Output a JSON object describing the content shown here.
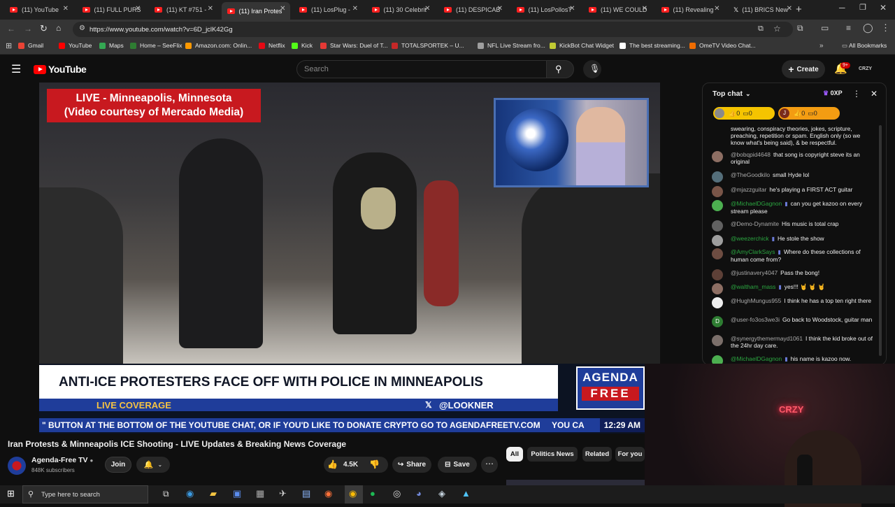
{
  "browser": {
    "tabs": [
      {
        "title": "(11) YouTube",
        "active": false
      },
      {
        "title": "(11) FULL PURS",
        "active": false
      },
      {
        "title": "(11) KT #751 - ",
        "active": false
      },
      {
        "title": "(11) Iran Protes",
        "active": true
      },
      {
        "title": "(11) LosPlug - ",
        "active": false
      },
      {
        "title": "(11) 30 Celebrit",
        "active": false
      },
      {
        "title": "(11) DESPICAB",
        "active": false
      },
      {
        "title": "(11) LosPollosT",
        "active": false
      },
      {
        "title": "(11) WE COULD",
        "active": false
      },
      {
        "title": "(11) Revealing",
        "active": false
      },
      {
        "title": "(11) BRICS New",
        "active": false
      }
    ],
    "url": "https://www.youtube.com/watch?v=6D_jclK42Gg",
    "bookmarks": [
      {
        "label": "Gmail",
        "color": "#ea4335"
      },
      {
        "label": "YouTube",
        "color": "#ff0000"
      },
      {
        "label": "Maps",
        "color": "#34a853"
      },
      {
        "label": "Home – SeeFlix",
        "color": "#2e7d32"
      },
      {
        "label": "Amazon.com: Onlin...",
        "color": "#ff9900"
      },
      {
        "label": "Netflix",
        "color": "#e50914"
      },
      {
        "label": "Kick",
        "color": "#53fc18"
      },
      {
        "label": "Star Wars: Duel of T...",
        "color": "#e53935"
      },
      {
        "label": "TOTALSPORTEK – U...",
        "color": "#c62828"
      },
      {
        "label": "NFL Live Stream fro...",
        "color": "#9e9e9e"
      },
      {
        "label": "KickBot Chat Widget",
        "color": "#c0ca33"
      },
      {
        "label": "The best streaming...",
        "color": "#ffffff"
      },
      {
        "label": "OmeTV Video Chat...",
        "color": "#ef6c00"
      }
    ],
    "all_bookmarks": "All Bookmarks"
  },
  "youtube": {
    "logo": "YouTube",
    "search_placeholder": "Search",
    "create_label": "Create",
    "notif_count": "9+",
    "avatar_text": "CRZY"
  },
  "video": {
    "overlay_line1": "LIVE - Minneapolis, Minnesota",
    "overlay_line2": "(Video courtesy of Mercado Media)",
    "headline": "ANTI-ICE PROTESTERS FACE OFF WITH POLICE IN MINNEAPOLIS",
    "live_coverage": "LIVE COVERAGE",
    "handle": "@LOOKNER",
    "logo_line1": "AGENDA",
    "logo_line2": "FREE",
    "ticker": "\" BUTTON AT THE BOTTOM OF THE YOUTUBE CHAT, OR IF YOU'D LIKE TO DONATE CRYPTO GO TO AGENDAFREETV.COM     YOU CA",
    "clock": "12:29 AM"
  },
  "info": {
    "title": "Iran Protests & Minneapolis ICE Shooting - LIVE Updates & Breaking News Coverage",
    "channel": "Agenda-Free TV",
    "subscribers": "848K subscribers",
    "join": "Join",
    "likes": "4.5K",
    "share": "Share",
    "save": "Save",
    "chips": [
      "All",
      "Politics News",
      "Related",
      "For you"
    ]
  },
  "chat": {
    "header": "Top chat",
    "xp": "0XP",
    "pill1_likes": "0",
    "pill1_comments": "0",
    "pill2_initial": "J",
    "pill2_likes": "0",
    "pill2_comments": "0",
    "rules_text": "swearing, conspiracy theories, jokes, scripture, preaching, repetition or spam. English only (so we know what's being said), & be respectful.",
    "messages": [
      {
        "author": "@bobqpid4648",
        "text": "that song is copyright steve its an original",
        "member": false,
        "avatar": "#8d6e63"
      },
      {
        "author": "@TheGoodkilo",
        "text": "small Hyde lol",
        "member": false,
        "avatar": "#546e7a"
      },
      {
        "author": "@mjazzguitar",
        "text": "he's playing a FIRST ACT guitar",
        "member": false,
        "avatar": "#795548"
      },
      {
        "author": "@MichaelDGagnon",
        "text": "can you get kazoo on every stream please",
        "member": true,
        "avatar": "#4caf50"
      },
      {
        "author": "@Demo-Dynamite",
        "text": "His music is total crap",
        "member": false,
        "avatar": "#616161"
      },
      {
        "author": "@weezerchick",
        "text": "He stole the show",
        "member": true,
        "avatar": "#9e9e9e"
      },
      {
        "author": "@AmyClarkSays",
        "text": "Where do these collections of human come from?",
        "member": true,
        "avatar": "#6d4c41"
      },
      {
        "author": "@justinavery4047",
        "text": "Pass the bong!",
        "member": false,
        "avatar": "#5d4037"
      },
      {
        "author": "@waltham_mass",
        "text": "yes!!! 🤘 🤘 🤘",
        "member": true,
        "avatar": "#8d6e63"
      },
      {
        "author": "@HughMungus955",
        "text": "I think he has a top ten right there",
        "member": false,
        "avatar": "#eeeeee"
      },
      {
        "author": "@user-fo3os3we3i",
        "text": "Go back to Woodstock, guitar man",
        "member": false,
        "avatar": "#2e7d32",
        "initial": "D"
      },
      {
        "author": "@synergythemermayd1061",
        "text": "I think the kid broke out of the 24hr day care.",
        "member": false,
        "avatar": "#7b6f6a"
      },
      {
        "author": "@MichaelDGagnon",
        "text": "his name is kazoo now.",
        "member": true,
        "avatar": "#4caf50"
      }
    ]
  },
  "webcam": {
    "sign": "CRZY"
  },
  "taskbar": {
    "search_placeholder": "Type here to search"
  }
}
